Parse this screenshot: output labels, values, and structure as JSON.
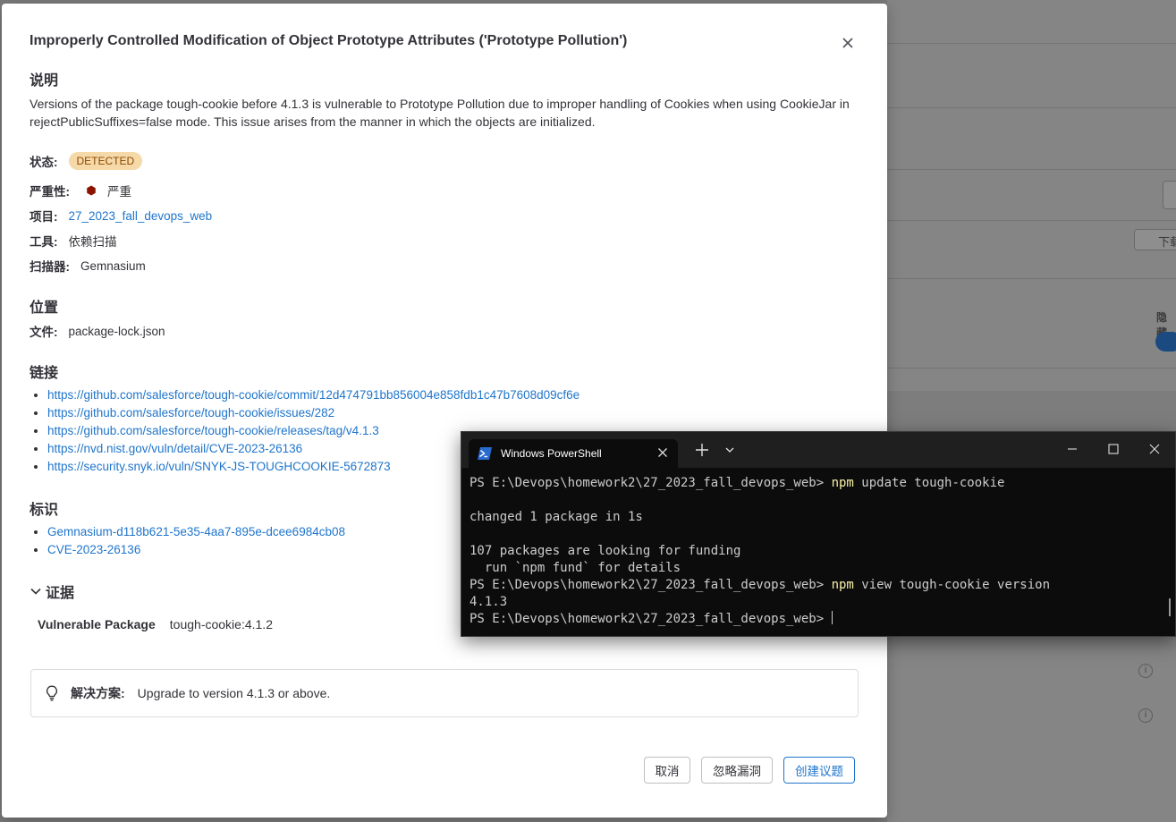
{
  "modal": {
    "title": "Improperly Controlled Modification of Object Prototype Attributes ('Prototype Pollution')",
    "description_heading": "说明",
    "description": "Versions of the package tough-cookie before 4.1.3 is vulnerable to Prototype Pollution due to improper handling of Cookies when using CookieJar in rejectPublicSuffixes=false mode. This issue arises from the manner in which the objects are initialized.",
    "status_label": "状态:",
    "status_value": "DETECTED",
    "severity_label": "严重性:",
    "severity_value": "严重",
    "project_label": "项目:",
    "project_value": "27_2023_fall_devops_web",
    "tool_label": "工具:",
    "tool_value": "依赖扫描",
    "scanner_label": "扫描器:",
    "scanner_value": "Gemnasium",
    "location_heading": "位置",
    "file_label": "文件:",
    "file_value": "package-lock.json",
    "links_heading": "链接",
    "links": [
      "https://github.com/salesforce/tough-cookie/commit/12d474791bb856004e858fdb1c47b7608d09cf6e",
      "https://github.com/salesforce/tough-cookie/issues/282",
      "https://github.com/salesforce/tough-cookie/releases/tag/v4.1.3",
      "https://nvd.nist.gov/vuln/detail/CVE-2023-26136",
      "https://security.snyk.io/vuln/SNYK-JS-TOUGHCOOKIE-5672873"
    ],
    "identifiers_heading": "标识",
    "identifiers": [
      "Gemnasium-d118b621-5e35-4aa7-895e-dcee6984cb08",
      "CVE-2023-26136"
    ],
    "evidence_heading": "证据",
    "evidence_key": "Vulnerable Package",
    "evidence_value": "tough-cookie:4.1.2",
    "solution_label": "解决方案:",
    "solution_value": "Upgrade to version 4.1.3 or above.",
    "cancel_label": "取消",
    "dismiss_label": "忽略漏洞",
    "create_issue_label": "创建议题"
  },
  "background": {
    "hide_label": "隐藏",
    "download_label": "下载"
  },
  "terminal": {
    "tab_title": "Windows PowerShell",
    "prompt1": "PS E:\\Devops\\homework2\\27_2023_fall_devops_web> ",
    "cmd1_npm": "npm",
    "cmd1_rest": " update tough-cookie",
    "out1": "changed 1 package in 1s",
    "out2": "107 packages are looking for funding",
    "out3": "  run `npm fund` for details",
    "prompt2": "PS E:\\Devops\\homework2\\27_2023_fall_devops_web> ",
    "cmd2_npm": "npm",
    "cmd2_rest": " view tough-cookie version",
    "out4": "4.1.3",
    "prompt3": "PS E:\\Devops\\homework2\\27_2023_fall_devops_web> "
  },
  "colors": {
    "accent": "#1f75cb",
    "badge_bg": "#f5d9a8",
    "badge_text": "#8f4700",
    "severity": "#8d1300",
    "terminal_bg": "#0c0c0c",
    "terminal_cmd": "#f9f1a5"
  }
}
